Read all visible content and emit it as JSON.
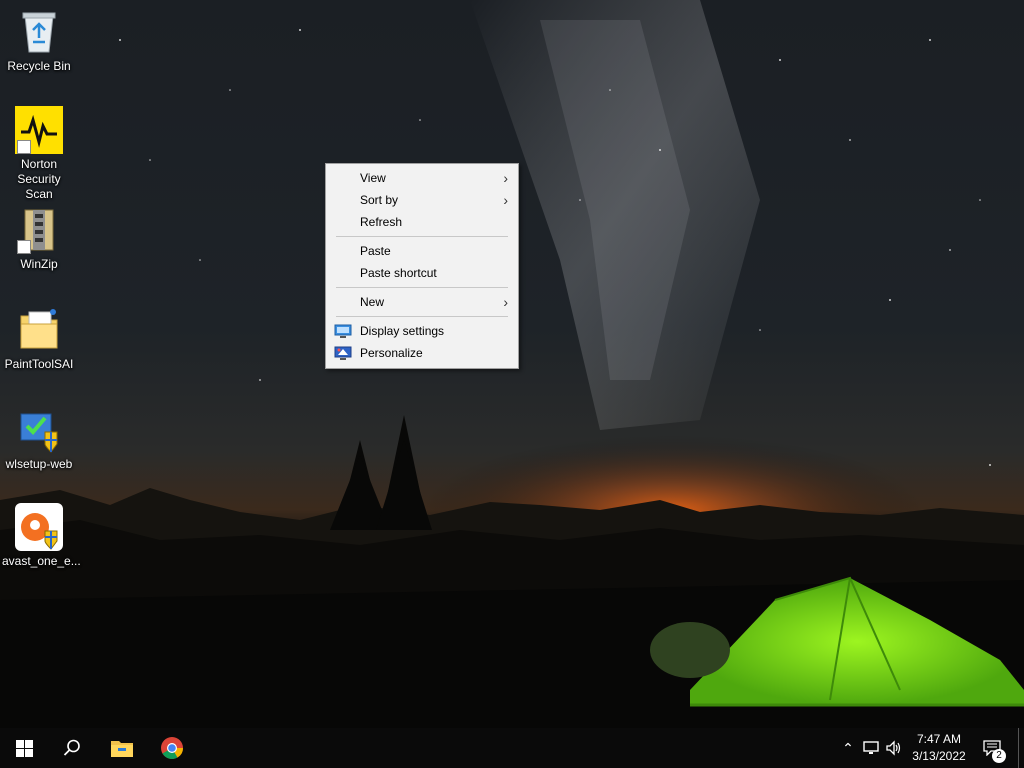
{
  "desktop": {
    "icons": [
      {
        "label": "Recycle Bin"
      },
      {
        "label": "Norton Security Scan"
      },
      {
        "label": "WinZip"
      },
      {
        "label": "PaintToolSAI"
      },
      {
        "label": "wlsetup-web"
      },
      {
        "label": "avast_one_e..."
      }
    ]
  },
  "context_menu": {
    "items": [
      {
        "label": "View",
        "submenu": true
      },
      {
        "label": "Sort by",
        "submenu": true
      },
      {
        "label": "Refresh"
      },
      {
        "label": "Paste"
      },
      {
        "label": "Paste shortcut"
      },
      {
        "label": "New",
        "submenu": true
      },
      {
        "label": "Display settings",
        "icon": "display-icon"
      },
      {
        "label": "Personalize",
        "icon": "personalize-icon"
      }
    ]
  },
  "taskbar": {
    "clock": {
      "time": "7:47 AM",
      "date": "3/13/2022"
    },
    "notifications_count": "2",
    "colors": {
      "background": "#0a0a0a",
      "start_logo": "#ffffff"
    }
  }
}
